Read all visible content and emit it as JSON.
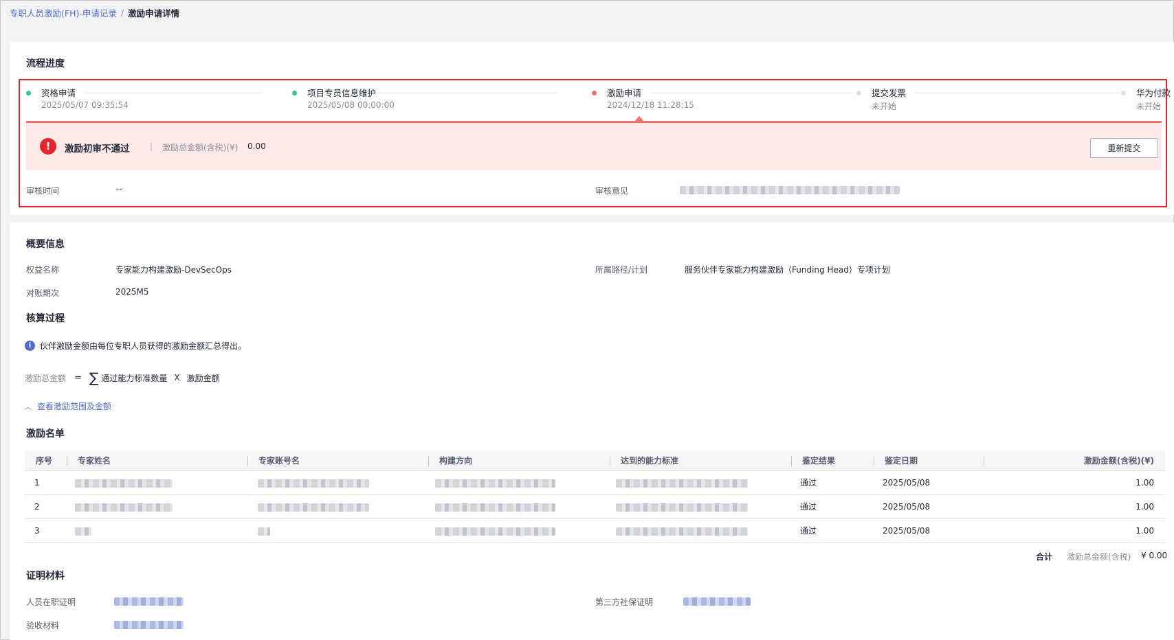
{
  "breadcrumb": {
    "parent": "专职人员激励(FH)-申请记录",
    "separator": "/",
    "current": "激励申请详情"
  },
  "progress": {
    "title": "流程进度",
    "steps": [
      {
        "name": "资格申请",
        "time": "2025/05/07 09:35:54",
        "status": "done"
      },
      {
        "name": "项目专员信息维护",
        "time": "2025/05/08 00:00:00",
        "status": "done"
      },
      {
        "name": "激励申请",
        "time": "2024/12/18 11:28:15",
        "status": "error"
      },
      {
        "name": "提交发票",
        "time": "未开始",
        "status": "pending"
      },
      {
        "name": "华为付款",
        "time": "未开始",
        "status": "pending"
      }
    ],
    "alert": {
      "icon": "error-icon",
      "icon_glyph": "!",
      "title": "激励初审不通过",
      "separator": "|",
      "amount_label": "激励总金额(含税)(¥)",
      "amount_value": "0.00",
      "resubmit_button": "重新提交"
    },
    "review": {
      "time_label": "审核时间",
      "time_value": "--",
      "opinion_label": "审核意见"
    },
    "colors": {
      "done": "#3ac295",
      "error": "#f66f6a",
      "pending": "#dfe1e6",
      "alert_bg": "#fde9e8"
    }
  },
  "summary": {
    "title": "概要信息",
    "benefit_label": "权益名称",
    "benefit_value": "专家能力构建激励-DevSecOps",
    "path_label": "所属路径/计划",
    "path_value": "服务伙伴专家能力构建激励（Funding Head）专项计划",
    "period_label": "对账期次",
    "period_value": "2025M5"
  },
  "calculation": {
    "title": "核算过程",
    "info_icon": "info-icon",
    "info_text": "伙伴激励金额由每位专职人员获得的激励金额汇总得出。",
    "formula_label": "激励总金额",
    "formula_eq": "=",
    "formula_sum": "∑",
    "formula_term1": "通过能力标准数量",
    "formula_times": "X",
    "formula_term2": "激励金额",
    "toggle_link": "查看激励范围及金额",
    "toggle_icon": "chevron-up-icon"
  },
  "roster": {
    "title": "激励名单",
    "columns": [
      "序号",
      "专家姓名",
      "专家账号名",
      "构建方向",
      "达到的能力标准",
      "鉴定结果",
      "鉴定日期",
      "激励金额(含税)(¥)"
    ],
    "rows": [
      {
        "index": "1",
        "result": "通过",
        "date": "2025/05/08",
        "amount": "1.00"
      },
      {
        "index": "2",
        "result": "通过",
        "date": "2025/05/08",
        "amount": "1.00"
      },
      {
        "index": "3",
        "result": "通过",
        "date": "2025/05/08",
        "amount": "1.00"
      }
    ],
    "total_label": "合计",
    "total_amount_label": "激励总金额(含税)",
    "total_amount_value": "¥ 0.00"
  },
  "materials": {
    "title": "证明材料",
    "employment_label": "人员在职证明",
    "social_security_label": "第三方社保证明",
    "acceptance_label": "验收材料"
  }
}
